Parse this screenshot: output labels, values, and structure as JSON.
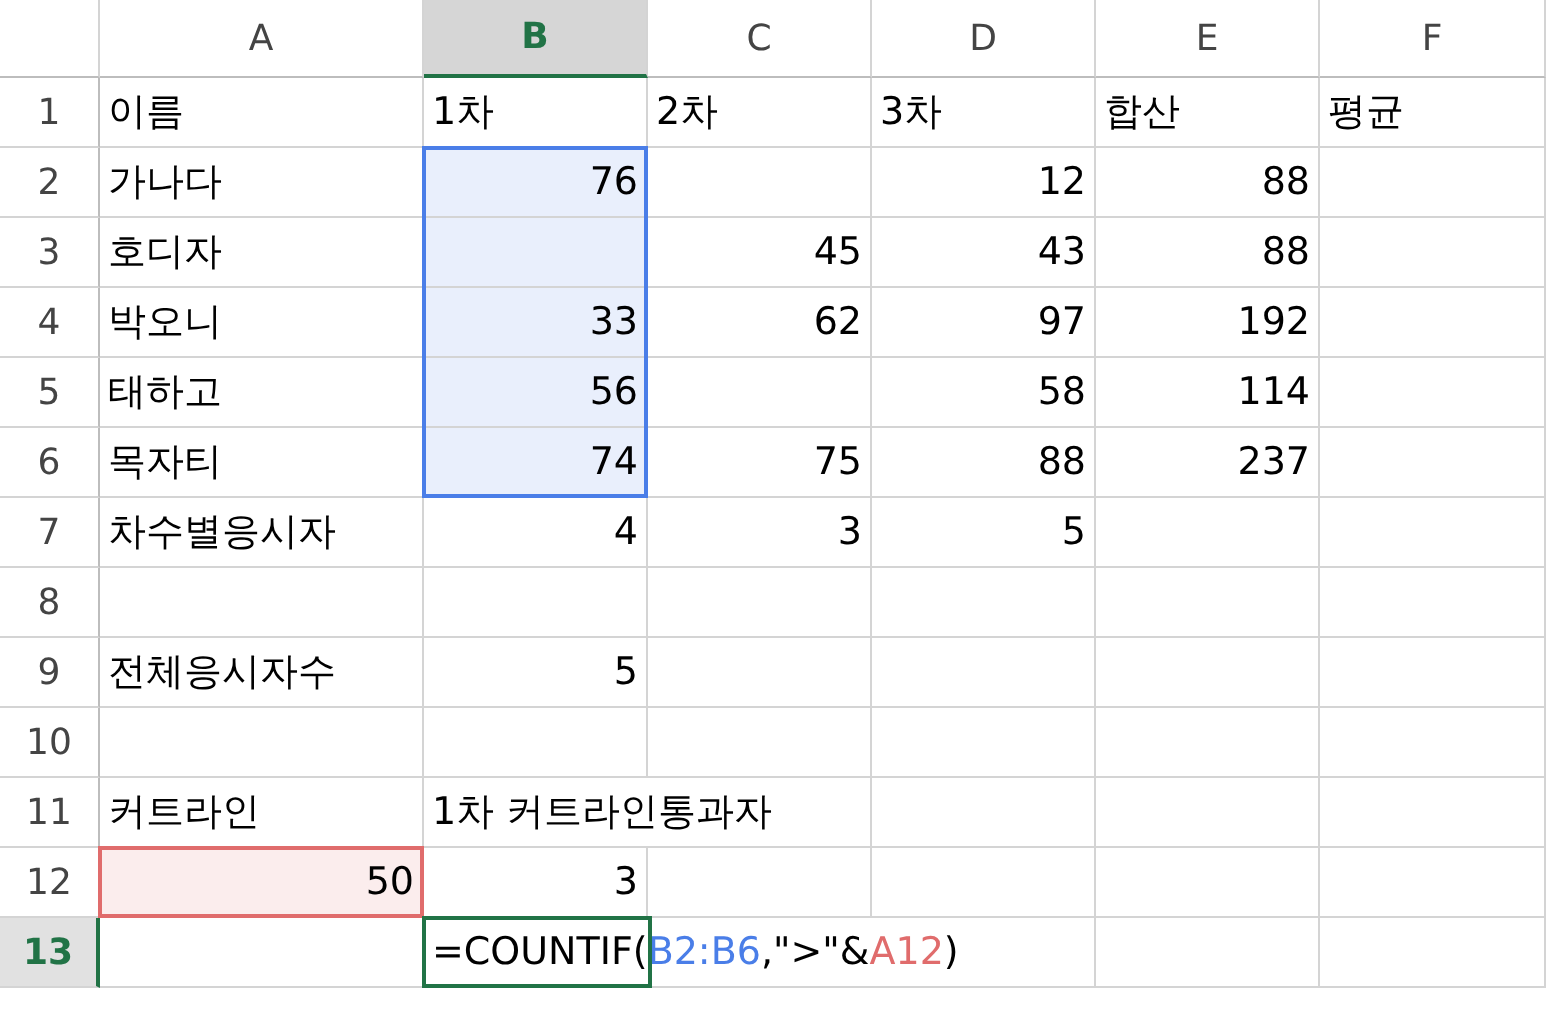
{
  "columns": [
    {
      "label": "A",
      "selected": false
    },
    {
      "label": "B",
      "selected": true
    },
    {
      "label": "C",
      "selected": false
    },
    {
      "label": "D",
      "selected": false
    },
    {
      "label": "E",
      "selected": false
    },
    {
      "label": "F",
      "selected": false
    }
  ],
  "rows": [
    {
      "label": "1",
      "selected": false,
      "cells": [
        {
          "kind": "label",
          "text": "이름"
        },
        {
          "kind": "label",
          "text": "1차"
        },
        {
          "kind": "label",
          "text": "2차"
        },
        {
          "kind": "label",
          "text": "3차"
        },
        {
          "kind": "label",
          "text": "합산"
        },
        {
          "kind": "label",
          "text": "평균"
        }
      ]
    },
    {
      "label": "2",
      "selected": false,
      "cells": [
        {
          "kind": "label",
          "text": "가나다"
        },
        {
          "kind": "number",
          "text": "76",
          "color": "#4a7ee8"
        },
        {
          "kind": "empty"
        },
        {
          "kind": "number",
          "text": "12"
        },
        {
          "kind": "number",
          "text": "88"
        },
        {
          "kind": "empty"
        }
      ]
    },
    {
      "label": "3",
      "selected": false,
      "cells": [
        {
          "kind": "label",
          "text": "호디자"
        },
        {
          "kind": "empty",
          "color": "#4a7ee8"
        },
        {
          "kind": "number",
          "text": "45"
        },
        {
          "kind": "number",
          "text": "43"
        },
        {
          "kind": "number",
          "text": "88"
        },
        {
          "kind": "empty"
        }
      ]
    },
    {
      "label": "4",
      "selected": false,
      "cells": [
        {
          "kind": "label",
          "text": "박오니"
        },
        {
          "kind": "number",
          "text": "33",
          "color": "#4a7ee8"
        },
        {
          "kind": "number",
          "text": "62"
        },
        {
          "kind": "number",
          "text": "97"
        },
        {
          "kind": "number",
          "text": "192"
        },
        {
          "kind": "empty"
        }
      ]
    },
    {
      "label": "5",
      "selected": false,
      "cells": [
        {
          "kind": "label",
          "text": "태하고"
        },
        {
          "kind": "number",
          "text": "56",
          "color": "#4a7ee8"
        },
        {
          "kind": "empty"
        },
        {
          "kind": "number",
          "text": "58"
        },
        {
          "kind": "number",
          "text": "114"
        },
        {
          "kind": "empty"
        }
      ]
    },
    {
      "label": "6",
      "selected": false,
      "cells": [
        {
          "kind": "label",
          "text": "목자티"
        },
        {
          "kind": "number",
          "text": "74",
          "color": "#4a7ee8"
        },
        {
          "kind": "number",
          "text": "75"
        },
        {
          "kind": "number",
          "text": "88"
        },
        {
          "kind": "number",
          "text": "237"
        },
        {
          "kind": "empty"
        }
      ]
    },
    {
      "label": "7",
      "selected": false,
      "cells": [
        {
          "kind": "label",
          "text": "차수별응시자"
        },
        {
          "kind": "number",
          "text": "4"
        },
        {
          "kind": "number",
          "text": "3"
        },
        {
          "kind": "number",
          "text": "5"
        },
        {
          "kind": "empty"
        },
        {
          "kind": "empty"
        }
      ]
    },
    {
      "label": "8",
      "selected": false,
      "cells": [
        {
          "kind": "empty"
        },
        {
          "kind": "empty"
        },
        {
          "kind": "empty"
        },
        {
          "kind": "empty"
        },
        {
          "kind": "empty"
        },
        {
          "kind": "empty"
        }
      ]
    },
    {
      "label": "9",
      "selected": false,
      "cells": [
        {
          "kind": "label",
          "text": "전체응시자수"
        },
        {
          "kind": "number",
          "text": "5"
        },
        {
          "kind": "empty"
        },
        {
          "kind": "empty"
        },
        {
          "kind": "empty"
        },
        {
          "kind": "empty"
        }
      ]
    },
    {
      "label": "10",
      "selected": false,
      "cells": [
        {
          "kind": "empty"
        },
        {
          "kind": "empty"
        },
        {
          "kind": "empty"
        },
        {
          "kind": "empty"
        },
        {
          "kind": "empty"
        },
        {
          "kind": "empty"
        }
      ]
    },
    {
      "label": "11",
      "selected": false,
      "cells": [
        {
          "kind": "label",
          "text": "커트라인"
        },
        {
          "kind": "label",
          "text": "1차 커트라인통과자"
        },
        {
          "kind": "empty"
        },
        {
          "kind": "empty"
        },
        {
          "kind": "empty"
        },
        {
          "kind": "empty"
        }
      ]
    },
    {
      "label": "12",
      "selected": false,
      "cells": [
        {
          "kind": "number",
          "text": "50",
          "color": "#e06c6c"
        },
        {
          "kind": "number",
          "text": "3"
        },
        {
          "kind": "empty"
        },
        {
          "kind": "empty"
        },
        {
          "kind": "empty"
        },
        {
          "kind": "empty"
        }
      ]
    },
    {
      "label": "13",
      "selected": true,
      "cells": [
        {
          "kind": "empty"
        },
        {
          "kind": "formula",
          "segments": [
            {
              "text": "=COUNTIF(",
              "color": "#000000"
            },
            {
              "text": "B2:B6",
              "color": "#4a7ee8"
            },
            {
              "text": ",\">\"&",
              "color": "#000000"
            },
            {
              "text": "A12",
              "color": "#e06c6c"
            },
            {
              "text": ")",
              "color": "#000000"
            }
          ]
        },
        {
          "kind": "empty"
        },
        {
          "kind": "empty"
        },
        {
          "kind": "empty"
        },
        {
          "kind": "empty"
        }
      ]
    }
  ]
}
